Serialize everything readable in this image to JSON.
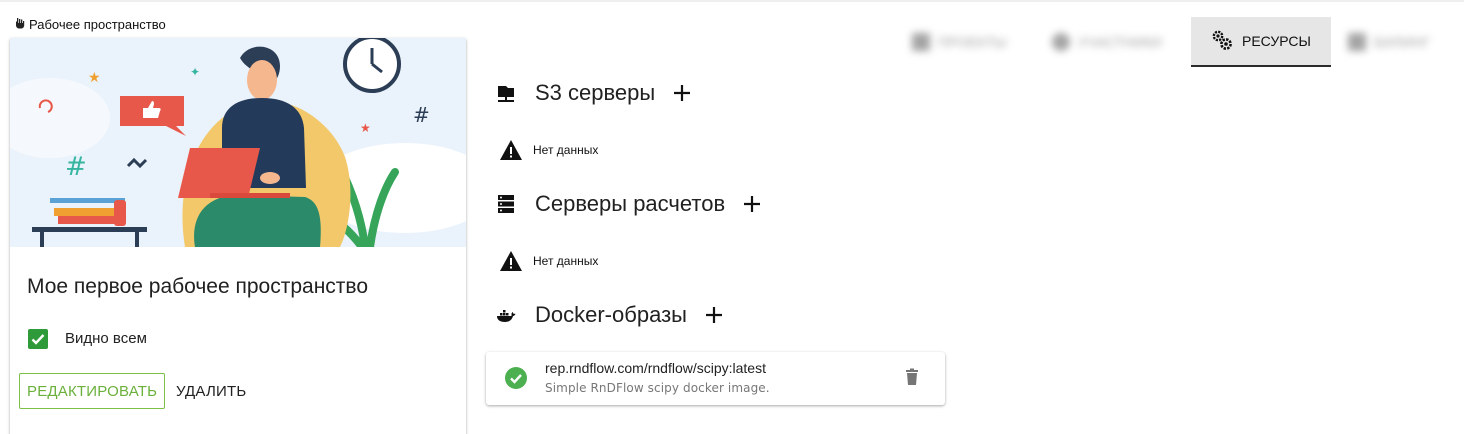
{
  "breadcrumb": {
    "label": "Рабочее пространство"
  },
  "workspace": {
    "title": "Мое первое рабочее пространство",
    "visibility_checked": true,
    "visibility_label": "Видно всем",
    "edit_label": "РЕДАКТИРОВАТЬ",
    "delete_label": "УДАЛИТЬ"
  },
  "tabs": [
    {
      "label": "ПРОЕКТЫ",
      "blurred": true
    },
    {
      "label": "УЧАСТНИКИ",
      "blurred": true
    },
    {
      "label": "РЕСУРСЫ",
      "active": true
    },
    {
      "label": "БИЛИНГ",
      "blurred": true
    }
  ],
  "sections": {
    "s3": {
      "title": "S3 серверы",
      "empty_text": "Нет данных"
    },
    "compute": {
      "title": "Серверы расчетов",
      "empty_text": "Нет данных"
    },
    "docker": {
      "title": "Docker-образы"
    }
  },
  "docker_images": [
    {
      "name": "rep.rndflow.com/rndflow/scipy:latest",
      "description": "Simple RnDFlow scipy docker image.",
      "status": "ok"
    }
  ],
  "colors": {
    "accent_green": "#6ab03a",
    "check_green": "#2e9a3a",
    "status_ok": "#4caf50"
  }
}
